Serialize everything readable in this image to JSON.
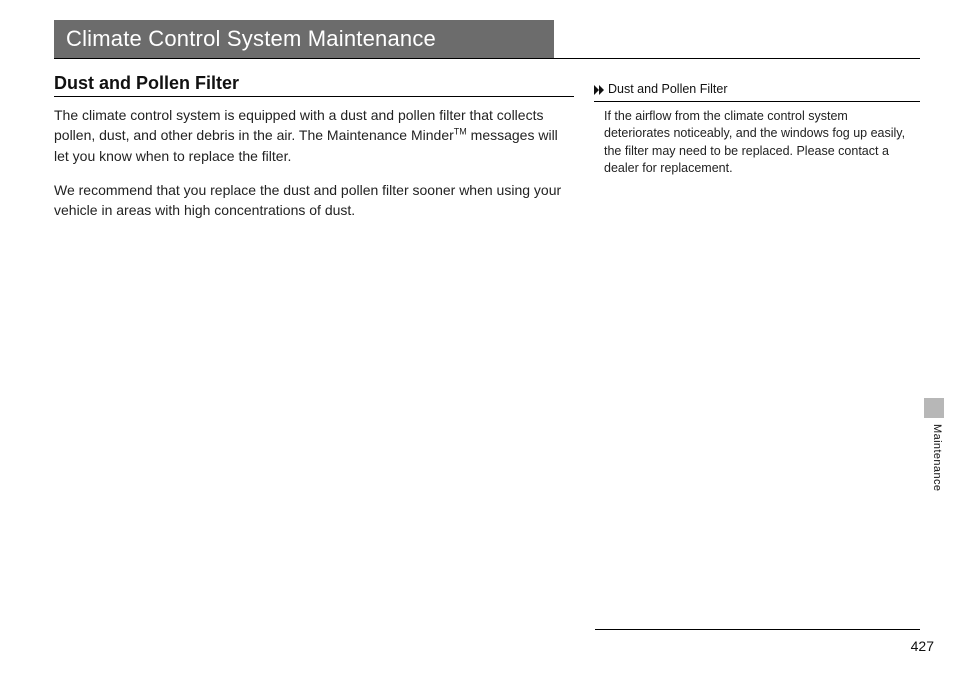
{
  "title": "Climate Control System Maintenance",
  "section_heading": "Dust and Pollen Filter",
  "paragraph1_pre": "The climate control system is equipped with a dust and pollen filter that collects pollen, dust, and other debris in the air. The Maintenance Minder",
  "tm": "TM",
  "paragraph1_post": " messages will let you know when to replace the filter.",
  "paragraph2": "We recommend that you replace the dust and pollen filter sooner when using your vehicle in areas with high concentrations of dust.",
  "sidebar": {
    "heading": "Dust and Pollen Filter",
    "body": "If the airflow from the climate control system deteriorates noticeably, and the windows fog up easily, the filter may need to be replaced. Please contact a dealer for replacement."
  },
  "section_label": "Maintenance",
  "page_number": "427"
}
